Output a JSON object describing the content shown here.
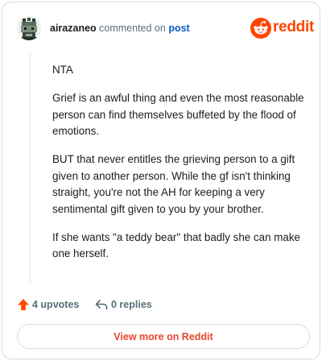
{
  "header": {
    "username": "airazaneo",
    "commented_text": "commented on",
    "post_link": "post",
    "brand_name": "reddit",
    "avatar_icon": "pixel-avatar-icon",
    "brand_icon": "reddit-snoo-icon"
  },
  "comment": {
    "paragraphs": [
      "NTA",
      "Grief is an awful thing and even the most reasonable person can find themselves buffeted by the flood of emotions.",
      "BUT that never entitles the grieving person to a gift given to another person. While the gf isn't thinking straight, you're not the AH for keeping a very sentimental gift given to you by your brother.",
      "If she wants \"a teddy bear\" that badly she can make one herself."
    ]
  },
  "actions": {
    "upvotes_label": "4 upvotes",
    "replies_label": "0 replies",
    "upvote_icon": "upvote-arrow-icon",
    "reply_icon": "reply-arrow-icon"
  },
  "footer": {
    "view_more_label": "View more on Reddit"
  },
  "colors": {
    "brand": "#ff4500",
    "link": "#0b5dc7",
    "muted": "#576f76",
    "button_text": "#e8452c"
  }
}
